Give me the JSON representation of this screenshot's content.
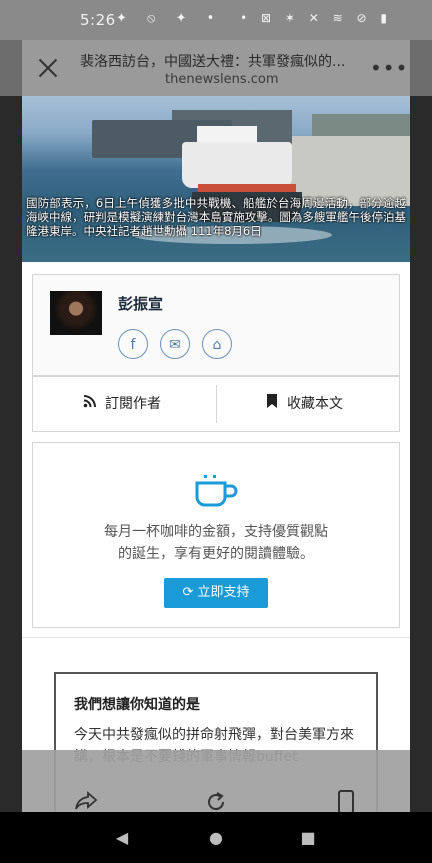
{
  "status_bar": {
    "time": "5:26",
    "left_icons": "✦ ⦸ ✦ •",
    "right_icons": "• ⊠ ✶ ✕ ≋ ⊘ ▮"
  },
  "toolbar": {
    "title": "裴洛西訪台，中國送大禮：共軍發瘋似的...",
    "url": "thenewslens.com",
    "more": "•••"
  },
  "hero": {
    "caption": "國防部表示，6日上午偵獲多批中共戰機、船艦於台海周邊活動，部分逾越海峽中線，研判是模擬演練對台灣本島實施攻擊。圖為多艘軍艦午後停泊基隆港東岸。中央社記者趙世勳攝 111年8月6日"
  },
  "author": {
    "name": "彭振宣",
    "social": {
      "facebook": "f",
      "email": "✉",
      "home": "⌂"
    }
  },
  "actions": {
    "subscribe": "訂閱作者",
    "bookmark": "收藏本文",
    "subscribe_icon": "rss-icon",
    "bookmark_icon": "bookmark-icon"
  },
  "support": {
    "text_line1": "每月一杯咖啡的金額，支持優質觀點",
    "text_line2": "的誕生，享有更好的閱讀體驗。",
    "button": "立即支持",
    "accent": "#1a9ad6"
  },
  "know": {
    "title": "我們想讓你知道的是",
    "text": "今天中共發瘋似的拼命射飛彈，對台美軍方來講，根本是不要錢的軍事情報buffet"
  },
  "bottom_bar": {
    "share_icon": "share-icon",
    "refresh_icon": "refresh-icon",
    "device_icon": "phone-icon"
  },
  "nav": {
    "back": "◀",
    "home": "●",
    "recents": "■"
  }
}
